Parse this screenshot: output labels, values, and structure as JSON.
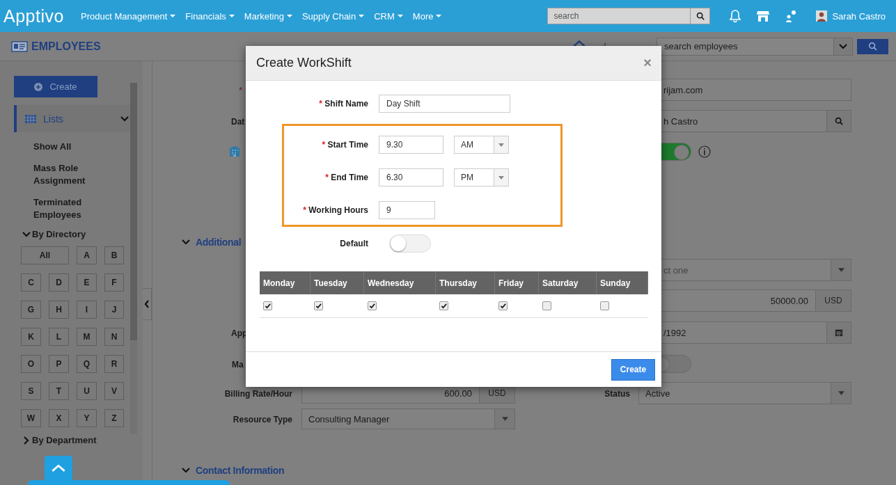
{
  "header": {
    "logo": "Apptivo",
    "nav": [
      {
        "label": "Product Management"
      },
      {
        "label": "Financials"
      },
      {
        "label": "Marketing"
      },
      {
        "label": "Supply Chain"
      },
      {
        "label": "CRM"
      },
      {
        "label": "More"
      }
    ],
    "search": {
      "placeholder": "search"
    },
    "user": "Sarah Castro"
  },
  "module": {
    "title": "EMPLOYEES",
    "search": {
      "placeholder": "search employees"
    }
  },
  "sidebar": {
    "create": "Create",
    "lists": {
      "label": "Lists",
      "expanded": true,
      "items": [
        "Show All",
        "Mass Role Assignment",
        "Terminated Employees"
      ]
    },
    "by_directory": {
      "label": "By Directory",
      "expanded": true,
      "letters": [
        "All",
        "A",
        "B",
        "C",
        "D",
        "E",
        "F",
        "G",
        "H",
        "I",
        "J",
        "K",
        "L",
        "M",
        "N",
        "O",
        "P",
        "Q",
        "R",
        "S",
        "T",
        "U",
        "V",
        "W",
        "X",
        "Y",
        "Z"
      ]
    },
    "by_department": {
      "label": "By Department",
      "expanded": false
    }
  },
  "form": {
    "required_mark": "*",
    "email_value": "rijam.com",
    "date_label": "Dat",
    "manager_value": "h Castro",
    "active_toggle": {
      "on": true
    },
    "section_additional": {
      "label": "Additional",
      "expanded": true
    },
    "select_placeholder": "ct one",
    "salary": {
      "value": "50000.00",
      "currency": "USD"
    },
    "app_label": "App",
    "date_value": "/1992",
    "ma_label": "Ma",
    "ma_toggle": {
      "on": false
    },
    "billing": {
      "label": "Billing Rate/Hour",
      "value": "600.00",
      "currency": "USD"
    },
    "status": {
      "label": "Status",
      "value": "Active"
    },
    "resource_type": {
      "label": "Resource Type",
      "value": "Consulting Manager"
    },
    "section_contact": {
      "label": "Contact Information",
      "expanded": true
    }
  },
  "dialog": {
    "title": "Create WorkShift",
    "close": "×",
    "required_mark": "*",
    "fields": [
      {
        "kind": "text",
        "label": "Shift Name",
        "required": true,
        "value": "Day Shift"
      }
    ],
    "highlighted_fields": [
      {
        "kind": "time",
        "label": "Start Time",
        "required": true,
        "value": "9.30",
        "period": "AM"
      },
      {
        "kind": "time",
        "label": "End Time",
        "required": true,
        "value": "6.30",
        "period": "PM"
      },
      {
        "kind": "number",
        "label": "Working Hours",
        "required": true,
        "value": "9"
      }
    ],
    "default_toggle": {
      "label": "Default",
      "on": false
    },
    "days": [
      {
        "label": "Monday",
        "checked": true
      },
      {
        "label": "Tuesday",
        "checked": true
      },
      {
        "label": "Wednesday",
        "checked": true
      },
      {
        "label": "Thursday",
        "checked": true
      },
      {
        "label": "Friday",
        "checked": true
      },
      {
        "label": "Saturday",
        "checked": false
      },
      {
        "label": "Sunday",
        "checked": false
      }
    ],
    "buttons": [
      "Create"
    ]
  }
}
